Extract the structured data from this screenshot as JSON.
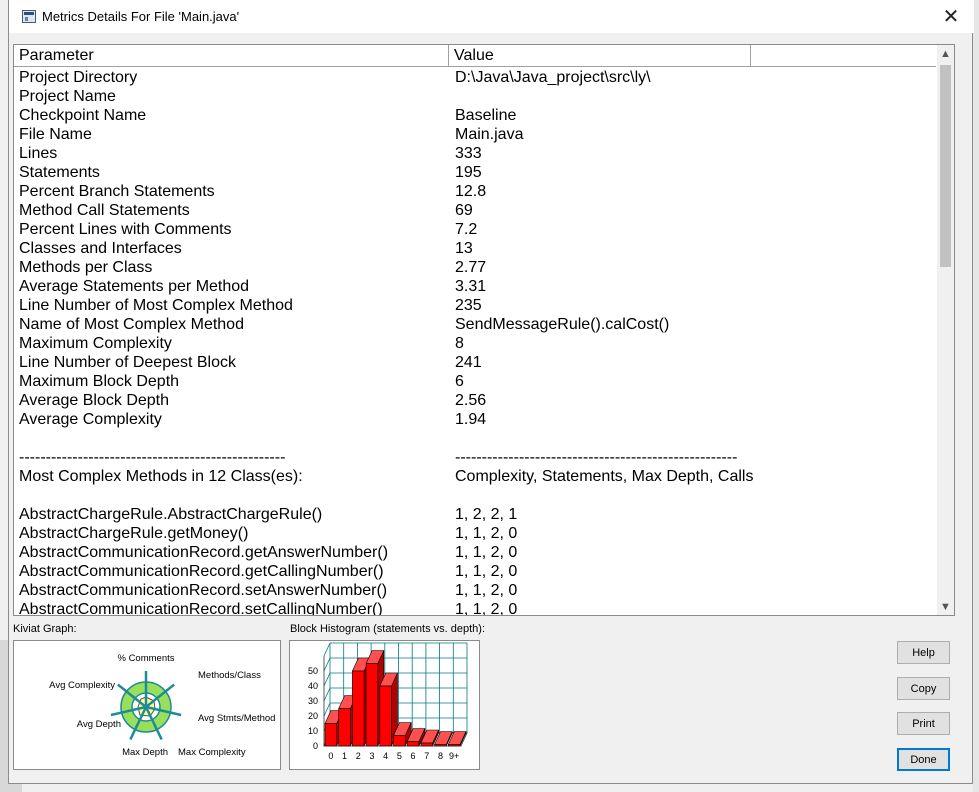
{
  "window": {
    "title": "Metrics Details For File 'Main.java'",
    "close_glyph": "✕"
  },
  "list": {
    "headers": {
      "parameter": "Parameter",
      "value": "Value"
    },
    "rows": [
      [
        "Project Directory",
        "D:\\Java\\Java_project\\src\\ly\\"
      ],
      [
        "Project Name",
        ""
      ],
      [
        "Checkpoint Name",
        "Baseline"
      ],
      [
        "File Name",
        "Main.java"
      ],
      [
        "Lines",
        "333"
      ],
      [
        "Statements",
        "195"
      ],
      [
        "Percent Branch Statements",
        "12.8"
      ],
      [
        "Method Call Statements",
        "69"
      ],
      [
        "Percent Lines with Comments",
        "7.2"
      ],
      [
        "Classes and Interfaces",
        "13"
      ],
      [
        "Methods per Class",
        "2.77"
      ],
      [
        "Average Statements per Method",
        "3.31"
      ],
      [
        "Line Number of Most Complex Method",
        "235"
      ],
      [
        "Name of Most Complex Method",
        "SendMessageRule().calCost()"
      ],
      [
        "Maximum Complexity",
        "8"
      ],
      [
        "Line Number of Deepest Block",
        "241"
      ],
      [
        "Maximum Block Depth",
        "6"
      ],
      [
        "Average Block Depth",
        "2.56"
      ],
      [
        "Average Complexity",
        "1.94"
      ],
      [
        "",
        ""
      ],
      [
        "--------------------------------------------------",
        "-----------------------------------------------------"
      ],
      [
        "Most Complex Methods in 12 Class(es):",
        "Complexity, Statements, Max Depth, Calls"
      ],
      [
        "",
        ""
      ],
      [
        "AbstractChargeRule.AbstractChargeRule()",
        "1, 2, 2, 1"
      ],
      [
        "AbstractChargeRule.getMoney()",
        "1, 1, 2, 0"
      ],
      [
        "AbstractCommunicationRecord.getAnswerNumber()",
        "1, 1, 2, 0"
      ],
      [
        "AbstractCommunicationRecord.getCallingNumber()",
        "1, 1, 2, 0"
      ],
      [
        "AbstractCommunicationRecord.setAnswerNumber()",
        "1, 1, 2, 0"
      ],
      [
        "AbstractCommunicationRecord.setCallingNumber()",
        "1, 1, 2, 0"
      ]
    ],
    "scroll_up_glyph": "▲",
    "scroll_down_glyph": "▼"
  },
  "kiviat": {
    "label": "Kiviat Graph:",
    "axes": [
      "% Comments",
      "Methods/Class",
      "Avg Stmts/Method",
      "Max Complexity",
      "Max Depth",
      "Avg Depth",
      "Avg Complexity"
    ]
  },
  "histogram": {
    "label": "Block Histogram (statements vs. depth):",
    "y_ticks": [
      "0",
      "10",
      "20",
      "30",
      "40",
      "50"
    ],
    "ylim": [
      0,
      60
    ],
    "categories": [
      "0",
      "1",
      "2",
      "3",
      "4",
      "5",
      "6",
      "7",
      "8",
      "9+"
    ],
    "values": [
      15,
      25,
      50,
      55,
      40,
      7,
      3,
      2,
      1,
      1
    ],
    "bar_color": "#ff0000",
    "grid_color": "#007a80"
  },
  "buttons": {
    "help": "Help",
    "copy": "Copy",
    "print": "Print",
    "done": "Done"
  }
}
